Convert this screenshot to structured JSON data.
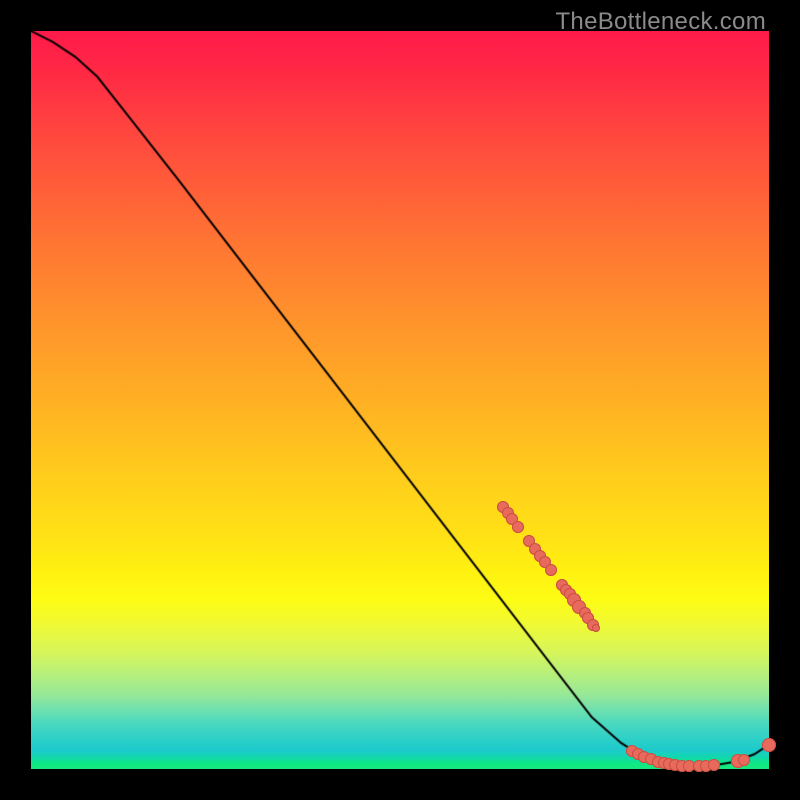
{
  "watermark": "TheBottleneck.com",
  "colors": {
    "point_fill": "#e86a5c",
    "point_stroke": "#c94f42",
    "curve": "#000000"
  },
  "chart_data": {
    "type": "line",
    "title": "",
    "xlabel": "",
    "ylabel": "",
    "xlim": [
      0,
      100
    ],
    "ylim": [
      0,
      100
    ],
    "curve": [
      {
        "x": 0.0,
        "y": 100.0
      },
      {
        "x": 3.0,
        "y": 98.5
      },
      {
        "x": 6.0,
        "y": 96.5
      },
      {
        "x": 9.0,
        "y": 93.8
      },
      {
        "x": 12.0,
        "y": 90.0
      },
      {
        "x": 20.0,
        "y": 79.8
      },
      {
        "x": 30.0,
        "y": 66.8
      },
      {
        "x": 40.0,
        "y": 53.8
      },
      {
        "x": 50.0,
        "y": 40.8
      },
      {
        "x": 60.0,
        "y": 27.8
      },
      {
        "x": 70.0,
        "y": 14.8
      },
      {
        "x": 76.0,
        "y": 7.0
      },
      {
        "x": 80.0,
        "y": 3.5
      },
      {
        "x": 83.0,
        "y": 1.6
      },
      {
        "x": 86.0,
        "y": 0.7
      },
      {
        "x": 89.0,
        "y": 0.35
      },
      {
        "x": 92.0,
        "y": 0.4
      },
      {
        "x": 95.0,
        "y": 0.9
      },
      {
        "x": 98.0,
        "y": 2.0
      },
      {
        "x": 100.0,
        "y": 3.3
      }
    ],
    "points": [
      {
        "x": 64.0,
        "y": 35.5,
        "r": 6
      },
      {
        "x": 64.6,
        "y": 34.7,
        "r": 6
      },
      {
        "x": 65.2,
        "y": 33.9,
        "r": 6
      },
      {
        "x": 66.0,
        "y": 32.8,
        "r": 6
      },
      {
        "x": 67.5,
        "y": 30.9,
        "r": 6
      },
      {
        "x": 68.3,
        "y": 29.8,
        "r": 6
      },
      {
        "x": 69.0,
        "y": 28.9,
        "r": 6
      },
      {
        "x": 69.6,
        "y": 28.1,
        "r": 6
      },
      {
        "x": 70.5,
        "y": 27.0,
        "r": 6
      },
      {
        "x": 72.0,
        "y": 25.0,
        "r": 6
      },
      {
        "x": 72.5,
        "y": 24.3,
        "r": 6
      },
      {
        "x": 73.0,
        "y": 23.7,
        "r": 6
      },
      {
        "x": 73.6,
        "y": 22.9,
        "r": 7
      },
      {
        "x": 74.3,
        "y": 22.0,
        "r": 7
      },
      {
        "x": 75.0,
        "y": 21.1,
        "r": 6
      },
      {
        "x": 75.5,
        "y": 20.4,
        "r": 6
      },
      {
        "x": 76.2,
        "y": 19.5,
        "r": 6
      },
      {
        "x": 76.5,
        "y": 19.1,
        "r": 4
      },
      {
        "x": 81.5,
        "y": 2.4,
        "r": 6
      },
      {
        "x": 82.3,
        "y": 2.0,
        "r": 6
      },
      {
        "x": 83.1,
        "y": 1.6,
        "r": 6
      },
      {
        "x": 84.0,
        "y": 1.3,
        "r": 6
      },
      {
        "x": 85.0,
        "y": 1.0,
        "r": 6
      },
      {
        "x": 85.8,
        "y": 0.8,
        "r": 6
      },
      {
        "x": 86.5,
        "y": 0.7,
        "r": 6
      },
      {
        "x": 87.3,
        "y": 0.55,
        "r": 6
      },
      {
        "x": 88.2,
        "y": 0.45,
        "r": 6
      },
      {
        "x": 89.2,
        "y": 0.4,
        "r": 6
      },
      {
        "x": 90.5,
        "y": 0.4,
        "r": 6
      },
      {
        "x": 91.5,
        "y": 0.45,
        "r": 6
      },
      {
        "x": 92.5,
        "y": 0.55,
        "r": 6
      },
      {
        "x": 95.8,
        "y": 1.05,
        "r": 7
      },
      {
        "x": 96.6,
        "y": 1.25,
        "r": 6
      },
      {
        "x": 100.0,
        "y": 3.3,
        "r": 7
      }
    ]
  }
}
